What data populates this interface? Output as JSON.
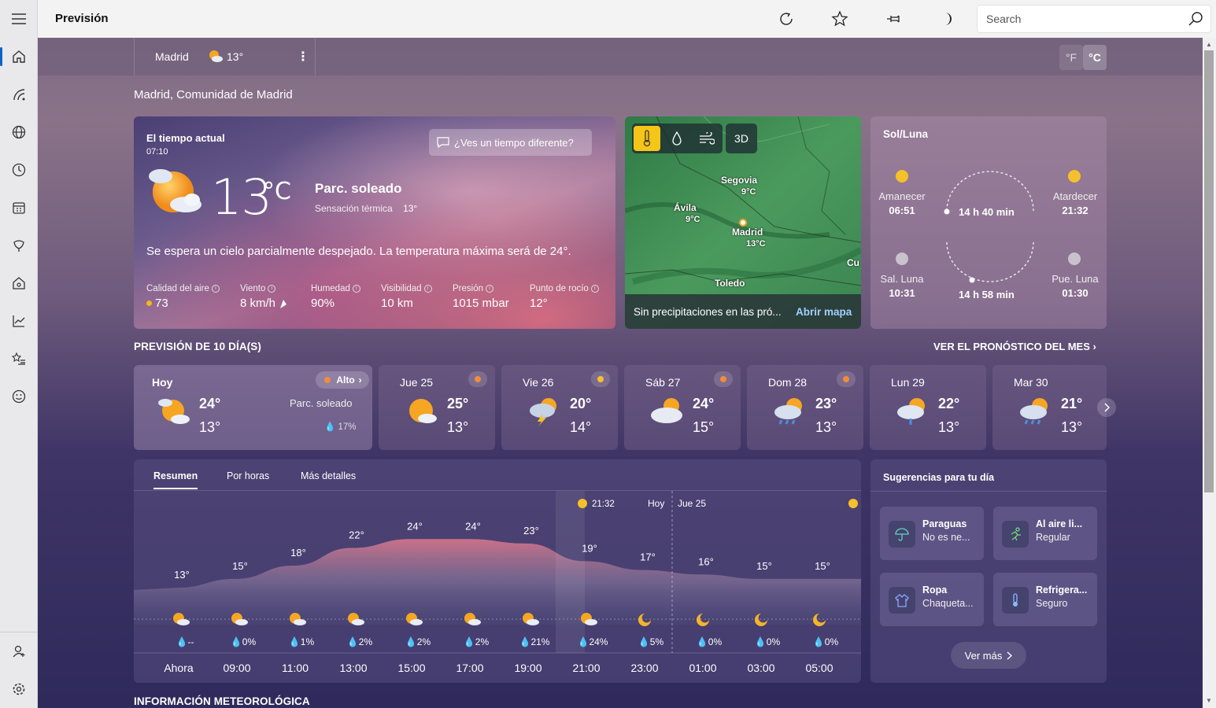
{
  "app": {
    "title": "Previsión"
  },
  "search": {
    "placeholder": "Search"
  },
  "location": {
    "city": "Madrid",
    "temp": "13°",
    "full_name": "Madrid, Comunidad de Madrid"
  },
  "units": {
    "f": "°F",
    "c": "°C"
  },
  "current": {
    "label": "El tiempo actual",
    "time": "07:10",
    "temp": "13",
    "unit": "°C",
    "condition": "Parc. soleado",
    "feels_label": "Sensación térmica",
    "feels_value": "13°",
    "feedback": "¿Ves un tiempo diferente?",
    "description": "Se espera un cielo parcialmente despejado. La temperatura máxima será de 24°.",
    "metrics": [
      {
        "label": "Calidad del aire",
        "value": "73"
      },
      {
        "label": "Viento",
        "value": "8 km/h"
      },
      {
        "label": "Humedad",
        "value": "90%"
      },
      {
        "label": "Visibilidad",
        "value": "10 km"
      },
      {
        "label": "Presión",
        "value": "1015 mbar"
      },
      {
        "label": "Punto de rocío",
        "value": "12°"
      }
    ]
  },
  "map": {
    "btn_3d": "3D",
    "footer_text": "Sin precipitaciones en las pró...",
    "open_map": "Abrir mapa",
    "cities": [
      {
        "name": "Segovia",
        "temp": "9°C"
      },
      {
        "name": "Ávila",
        "temp": "9°C"
      },
      {
        "name": "Madrid",
        "temp": "13°C"
      },
      {
        "name": "Toledo",
        "temp": ""
      },
      {
        "name": "Cu",
        "temp": ""
      }
    ]
  },
  "sun_moon": {
    "title": "Sol/Luna",
    "sunrise_label": "Amanecer",
    "sunrise": "06:51",
    "sunset_label": "Atardecer",
    "sunset": "21:32",
    "day_length": "14 h 40 min",
    "moonrise_label": "Sal. Luna",
    "moonrise": "10:31",
    "moonset_label": "Pue. Luna",
    "moonset": "01:30",
    "moon_length": "14 h 58 min"
  },
  "forecast": {
    "title": "PREVISIÓN DE 10 DÍA(S)",
    "month_link": "VER EL PRONÓSTICO DEL MES",
    "alert_label": "Alto",
    "days": [
      {
        "name": "Hoy",
        "hi": "24°",
        "lo": "13°",
        "cond": "Parc. soleado",
        "precip": "17%",
        "icon": "partly-sunny"
      },
      {
        "name": "Jue 25",
        "hi": "25°",
        "lo": "13°",
        "icon": "partly-sunny"
      },
      {
        "name": "Vie 26",
        "hi": "20°",
        "lo": "14°",
        "icon": "thunderstorm"
      },
      {
        "name": "Sáb 27",
        "hi": "24°",
        "lo": "15°",
        "icon": "cloudy"
      },
      {
        "name": "Dom 28",
        "hi": "23°",
        "lo": "13°",
        "icon": "rain-showers"
      },
      {
        "name": "Lun 29",
        "hi": "22°",
        "lo": "13°",
        "icon": "rain"
      },
      {
        "name": "Mar 30",
        "hi": "21°",
        "lo": "13°",
        "icon": "rain-showers"
      }
    ]
  },
  "tabs": [
    "Resumen",
    "Por horas",
    "Más detalles"
  ],
  "chart_data": {
    "type": "area",
    "title": "",
    "x": [
      "Ahora",
      "09:00",
      "11:00",
      "13:00",
      "15:00",
      "17:00",
      "19:00",
      "21:00",
      "23:00",
      "01:00",
      "03:00",
      "05:00"
    ],
    "temps": [
      13,
      15,
      18,
      22,
      24,
      24,
      23,
      19,
      17,
      16,
      15,
      15
    ],
    "temp_labels": [
      "13°",
      "15°",
      "18°",
      "22°",
      "24°",
      "24°",
      "23°",
      "19°",
      "17°",
      "16°",
      "15°",
      "15°"
    ],
    "precip": [
      "--",
      "0%",
      "1%",
      "2%",
      "2%",
      "2%",
      "21%",
      "24%",
      "5%",
      "0%",
      "0%",
      "0%"
    ],
    "sunset_label": "21:32",
    "today_label": "Hoy",
    "tomorrow_label": "Jue 25"
  },
  "suggestions": {
    "title": "Sugerencias para tu día",
    "items": [
      {
        "title": "Paraguas",
        "sub": "No es ne...",
        "icon": "umbrella-icon"
      },
      {
        "title": "Al aire li...",
        "sub": "Regular",
        "icon": "running-icon"
      },
      {
        "title": "Ropa",
        "sub": "Chaqueta...",
        "icon": "jacket-icon"
      },
      {
        "title": "Refrigera...",
        "sub": "Seguro",
        "icon": "thermometer-icon"
      }
    ],
    "more": "Ver más"
  },
  "info_section": {
    "title": "INFORMACIÓN METEOROLÓGICA"
  }
}
